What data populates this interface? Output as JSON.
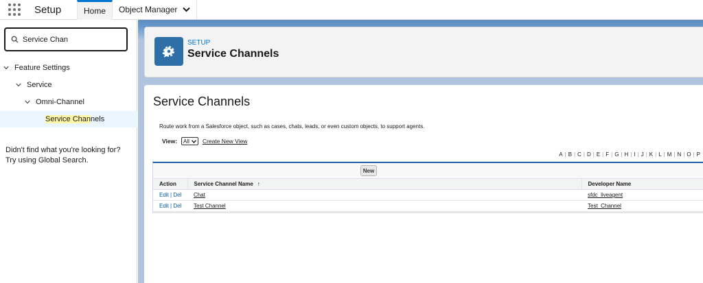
{
  "topbar": {
    "app_name": "Setup",
    "tabs": [
      {
        "label": "Home"
      },
      {
        "label": "Object Manager"
      }
    ]
  },
  "sidebar": {
    "search": {
      "value": "Service Chan",
      "placeholder": ""
    },
    "tree": [
      {
        "label": "Feature Settings"
      },
      {
        "label": "Service"
      },
      {
        "label": "Omni-Channel"
      },
      {
        "label_pre": "Service Chan",
        "label_post": "nels"
      }
    ],
    "help_line1": "Didn't find what you're looking for?",
    "help_line2": "Try using Global Search."
  },
  "header": {
    "eyebrow": "SETUP",
    "title": "Service Channels"
  },
  "content": {
    "title": "Service Channels",
    "description": "Route work from a Salesforce object, such as cases, chats, leads, or even custom objects, to support agents.",
    "view_label": "View:",
    "view_selected": "All",
    "create_new_view": "Create New View",
    "alphabet": [
      "A",
      "B",
      "C",
      "D",
      "E",
      "F",
      "G",
      "H",
      "I",
      "J",
      "K",
      "L",
      "M",
      "N",
      "O",
      "P"
    ],
    "new_button": "New",
    "columns": {
      "action": "Action",
      "name": "Service Channel Name",
      "name_sort": "↑",
      "developer": "Developer Name"
    },
    "rows": [
      {
        "edit": "Edit",
        "sep": "|",
        "del": "Del",
        "name": "Chat",
        "developer": "sfdc_liveagent"
      },
      {
        "edit": "Edit",
        "sep": "|",
        "del": "Del",
        "name": "Test Channel",
        "developer": "Test_Channel"
      }
    ]
  }
}
